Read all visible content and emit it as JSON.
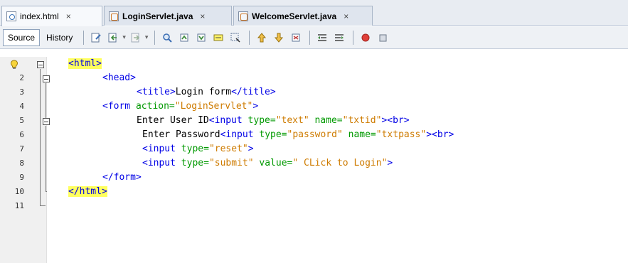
{
  "tabs": [
    {
      "label": "index.html",
      "bold": false,
      "icon": "html-file-icon",
      "active": true,
      "close": "×"
    },
    {
      "label": "LoginServlet.java",
      "bold": true,
      "icon": "java-file-icon",
      "active": false,
      "close": "×"
    },
    {
      "label": "WelcomeServlet.java",
      "bold": true,
      "icon": "java-file-icon",
      "active": false,
      "close": "×"
    }
  ],
  "toolbar": {
    "source_label": "Source",
    "history_label": "History",
    "icons": [
      "last-edit-icon",
      "back-icon",
      "forward-icon",
      "find-icon",
      "find-prev-icon",
      "find-next-icon",
      "toggle-highlight-icon",
      "select-icon",
      "shift-up-icon",
      "shift-down-icon",
      "bookmark-icon",
      "shift-left-icon",
      "shift-right-icon",
      "record-macro-icon",
      "stop-macro-icon"
    ]
  },
  "editor": {
    "line_numbers": [
      "1",
      "2",
      "3",
      "4",
      "5",
      "6",
      "7",
      "8",
      "9",
      "10",
      "11"
    ],
    "lines": [
      [
        {
          "t": "tag",
          "s": "<html>",
          "hl": true
        }
      ],
      [
        {
          "t": "tag",
          "s": "<head>"
        }
      ],
      [
        {
          "t": "tag",
          "s": "<title>"
        },
        {
          "t": "txt",
          "s": "Login form"
        },
        {
          "t": "tag",
          "s": "</title>"
        }
      ],
      [
        {
          "t": "tag",
          "s": "<form "
        },
        {
          "t": "attr",
          "s": "action="
        },
        {
          "t": "val",
          "s": "\"LoginServlet\""
        },
        {
          "t": "tag",
          "s": ">"
        }
      ],
      [
        {
          "t": "txt",
          "s": "Enter User ID"
        },
        {
          "t": "tag",
          "s": "<input "
        },
        {
          "t": "attr",
          "s": "type="
        },
        {
          "t": "val",
          "s": "\"text\""
        },
        {
          "t": "attr",
          "s": " name="
        },
        {
          "t": "val",
          "s": "\"txtid\""
        },
        {
          "t": "tag",
          "s": "><br>"
        }
      ],
      [
        {
          "t": "txt",
          "s": "Enter Password"
        },
        {
          "t": "tag",
          "s": "<input "
        },
        {
          "t": "attr",
          "s": "type="
        },
        {
          "t": "val",
          "s": "\"password\""
        },
        {
          "t": "attr",
          "s": " name="
        },
        {
          "t": "val",
          "s": "\"txtpass\""
        },
        {
          "t": "tag",
          "s": "><br>"
        }
      ],
      [
        {
          "t": "tag",
          "s": "<input "
        },
        {
          "t": "attr",
          "s": "type="
        },
        {
          "t": "val",
          "s": "\"reset\""
        },
        {
          "t": "tag",
          "s": ">"
        }
      ],
      [
        {
          "t": "tag",
          "s": "<input "
        },
        {
          "t": "attr",
          "s": "type="
        },
        {
          "t": "val",
          "s": "\"submit\""
        },
        {
          "t": "attr",
          "s": " value="
        },
        {
          "t": "val",
          "s": "\" CLick to Login\""
        },
        {
          "t": "tag",
          "s": ">"
        }
      ],
      [
        {
          "t": "tag",
          "s": "</form>"
        }
      ],
      [
        {
          "t": "tag",
          "s": "</html>",
          "hl": true
        }
      ],
      []
    ]
  }
}
